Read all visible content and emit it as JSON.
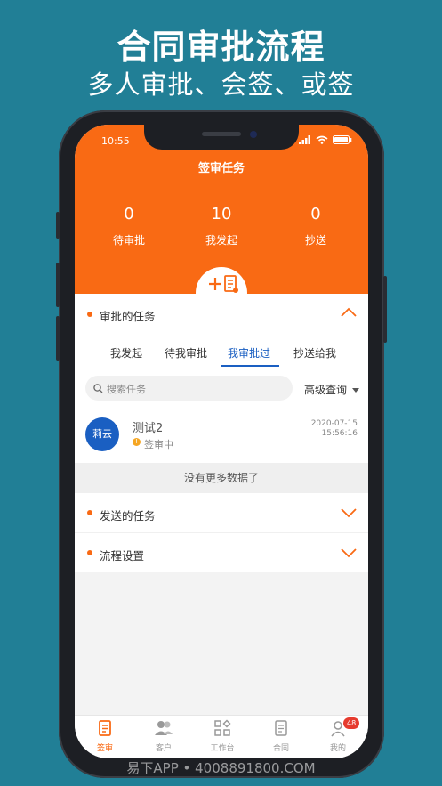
{
  "promo": {
    "title": "合同审批流程",
    "subtitle": "多人审批、会签、或签"
  },
  "status_bar": {
    "time": "10:55"
  },
  "header": {
    "title": "签审任务",
    "stats": [
      {
        "value": "0",
        "label": "待审批"
      },
      {
        "value": "10",
        "label": "我发起"
      },
      {
        "value": "0",
        "label": "抄送"
      }
    ]
  },
  "approval_section": {
    "title": "审批的任务",
    "tabs": [
      "我发起",
      "待我审批",
      "我审批过",
      "抄送给我"
    ],
    "active_tab": "我审批过",
    "search_placeholder": "搜索任务",
    "advanced_query": "高级查询",
    "tasks": [
      {
        "avatar_text": "莉云",
        "name": "测试2",
        "status": "签审中",
        "date": "2020-07-15",
        "time": "15:56:16"
      }
    ],
    "no_more": "没有更多数据了"
  },
  "sent_section": {
    "title": "发送的任务"
  },
  "flow_section": {
    "title": "流程设置"
  },
  "tabbar": {
    "items": [
      {
        "label": "签审",
        "icon": "approval-icon"
      },
      {
        "label": "客户",
        "icon": "customers-icon"
      },
      {
        "label": "工作台",
        "icon": "workbench-icon"
      },
      {
        "label": "合同",
        "icon": "contract-icon"
      },
      {
        "label": "我的",
        "icon": "profile-icon"
      }
    ],
    "badge": "48"
  },
  "watermark": "易下APP • 4008891800.COM",
  "colors": {
    "brand": "#f96a14",
    "accent": "#1a5fc2",
    "background": "#217f96"
  }
}
